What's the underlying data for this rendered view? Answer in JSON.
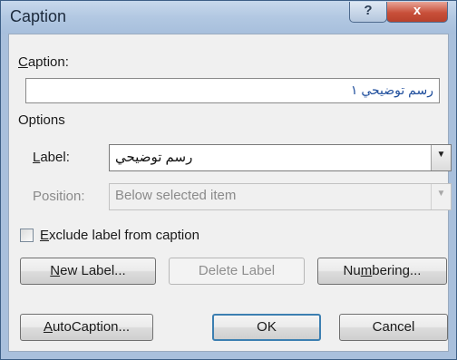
{
  "window": {
    "title": "Caption",
    "help_glyph": "?",
    "close_glyph": "x"
  },
  "caption": {
    "label_prefix": "",
    "label_hotkey": "C",
    "label_rest": "aption:",
    "value": "رسم توضيحي ١"
  },
  "options": {
    "heading": "Options",
    "label_field": {
      "label_hotkey": "L",
      "label_rest": "abel:",
      "value": "رسم توضيحي"
    },
    "position_field": {
      "label": "Position:",
      "value": "Below selected item"
    }
  },
  "exclude": {
    "prefix": "E",
    "rest": "xclude label from caption",
    "checked": false
  },
  "buttons": {
    "new_label": {
      "hotkey": "N",
      "rest": "ew Label..."
    },
    "delete_label": "Delete Label",
    "numbering": {
      "pre": "Nu",
      "hotkey": "m",
      "rest": "bering..."
    },
    "autocaption": {
      "hotkey": "A",
      "rest": "utoCaption..."
    },
    "ok": "OK",
    "cancel": "Cancel"
  },
  "icons": {
    "dropdown": "chevron-down-icon"
  }
}
